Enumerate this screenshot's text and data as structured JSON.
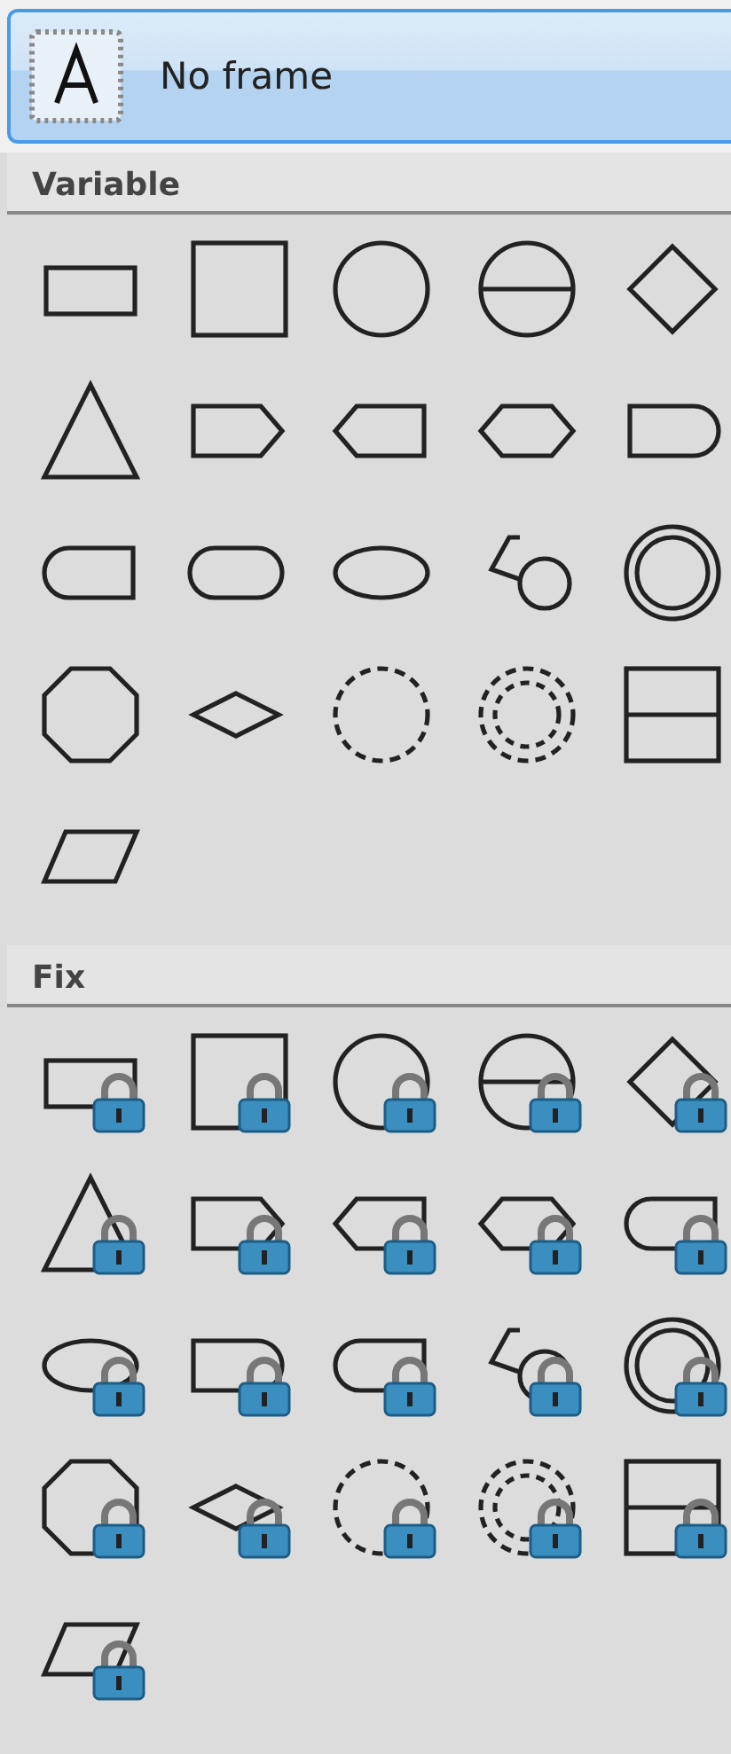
{
  "no_frame": {
    "label": "No frame",
    "selected": true
  },
  "sections": [
    {
      "title": "Variable",
      "items": [
        {
          "kind": "rectangle",
          "locked": false,
          "selected": false
        },
        {
          "kind": "square",
          "locked": false,
          "selected": false
        },
        {
          "kind": "circle",
          "locked": false,
          "selected": false
        },
        {
          "kind": "split-circle",
          "locked": false,
          "selected": false
        },
        {
          "kind": "diamond",
          "locked": false,
          "selected": false
        },
        {
          "kind": "triangle",
          "locked": false,
          "selected": false
        },
        {
          "kind": "pentagon-right",
          "locked": false,
          "selected": false
        },
        {
          "kind": "pentagon-left",
          "locked": false,
          "selected": false
        },
        {
          "kind": "hexagon",
          "locked": false,
          "selected": false
        },
        {
          "kind": "round-right",
          "locked": false,
          "selected": false
        },
        {
          "kind": "round-left",
          "locked": false,
          "selected": false
        },
        {
          "kind": "stadium",
          "locked": false,
          "selected": false
        },
        {
          "kind": "ellipse",
          "locked": false,
          "selected": false
        },
        {
          "kind": "balloon",
          "locked": false,
          "selected": false
        },
        {
          "kind": "double-circle",
          "locked": false,
          "selected": false
        },
        {
          "kind": "octagon",
          "locked": false,
          "selected": false
        },
        {
          "kind": "flat-diamond",
          "locked": false,
          "selected": false
        },
        {
          "kind": "dashed-circle",
          "locked": false,
          "selected": false
        },
        {
          "kind": "dashed-double-circle",
          "locked": false,
          "selected": false
        },
        {
          "kind": "split-square",
          "locked": false,
          "selected": false
        },
        {
          "kind": "parallelogram",
          "locked": false,
          "selected": false
        }
      ]
    },
    {
      "title": "Fix",
      "items": [
        {
          "kind": "rectangle",
          "locked": true,
          "selected": false
        },
        {
          "kind": "square",
          "locked": true,
          "selected": false
        },
        {
          "kind": "circle",
          "locked": true,
          "selected": false
        },
        {
          "kind": "split-circle",
          "locked": true,
          "selected": false
        },
        {
          "kind": "diamond",
          "locked": true,
          "selected": false
        },
        {
          "kind": "triangle",
          "locked": true,
          "selected": false
        },
        {
          "kind": "pentagon-right",
          "locked": true,
          "selected": false
        },
        {
          "kind": "pentagon-left",
          "locked": true,
          "selected": false
        },
        {
          "kind": "hexagon",
          "locked": true,
          "selected": false
        },
        {
          "kind": "round-left",
          "locked": true,
          "selected": false
        },
        {
          "kind": "ellipse",
          "locked": true,
          "selected": false
        },
        {
          "kind": "round-right",
          "locked": true,
          "selected": false
        },
        {
          "kind": "round-left",
          "locked": true,
          "selected": false
        },
        {
          "kind": "balloon",
          "locked": true,
          "selected": false
        },
        {
          "kind": "double-circle",
          "locked": true,
          "selected": false
        },
        {
          "kind": "octagon",
          "locked": true,
          "selected": false
        },
        {
          "kind": "flat-diamond",
          "locked": true,
          "selected": false
        },
        {
          "kind": "dashed-circle",
          "locked": true,
          "selected": false
        },
        {
          "kind": "dashed-double-circle",
          "locked": true,
          "selected": false
        },
        {
          "kind": "split-square",
          "locked": true,
          "selected": false
        },
        {
          "kind": "parallelogram",
          "locked": true,
          "selected": false
        }
      ]
    }
  ]
}
